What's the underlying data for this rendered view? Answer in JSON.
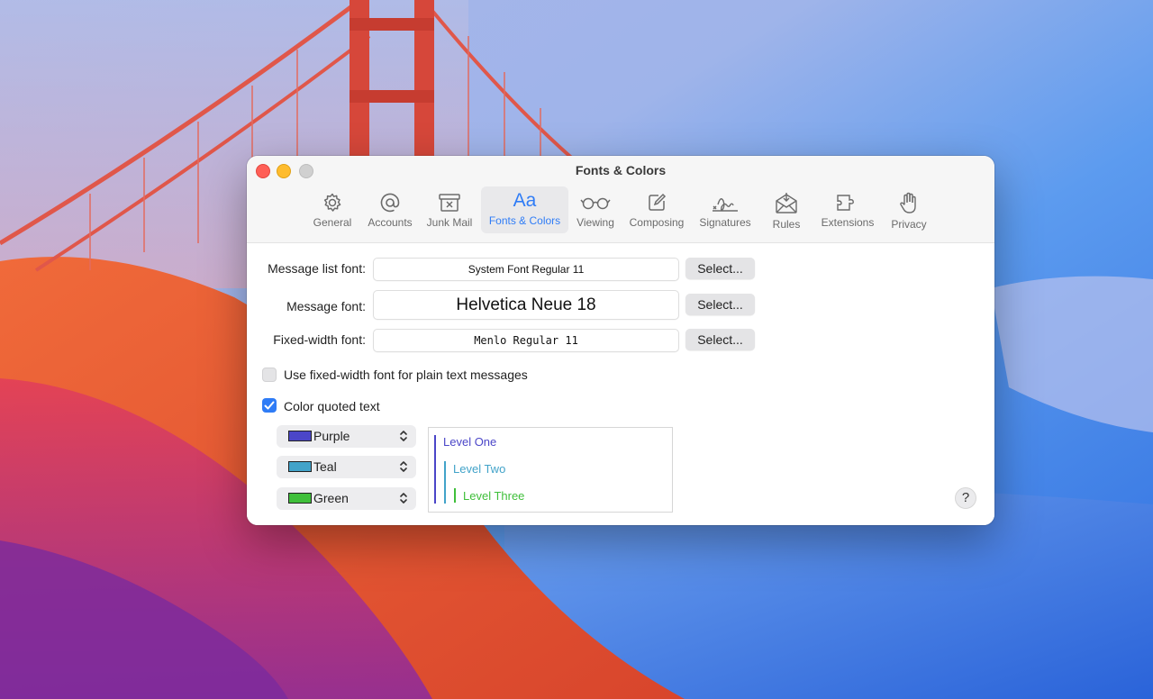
{
  "window": {
    "title": "Fonts & Colors"
  },
  "toolbar": {
    "items": [
      {
        "label": "General",
        "icon": "gear-icon"
      },
      {
        "label": "Accounts",
        "icon": "at-sign-icon"
      },
      {
        "label": "Junk Mail",
        "icon": "junk-mail-icon"
      },
      {
        "label": "Fonts & Colors",
        "icon": "fonts-icon",
        "glyph": "Aa",
        "selected": true
      },
      {
        "label": "Viewing",
        "icon": "glasses-icon"
      },
      {
        "label": "Composing",
        "icon": "compose-icon"
      },
      {
        "label": "Signatures",
        "icon": "signature-icon"
      },
      {
        "label": "Rules",
        "icon": "rules-envelope-icon"
      },
      {
        "label": "Extensions",
        "icon": "puzzle-icon"
      },
      {
        "label": "Privacy",
        "icon": "hand-icon"
      }
    ]
  },
  "fonts": {
    "message_list": {
      "label": "Message list font:",
      "value": "System Font Regular 11",
      "button": "Select..."
    },
    "message": {
      "label": "Message font:",
      "value": "Helvetica Neue 18",
      "button": "Select..."
    },
    "fixed_width": {
      "label": "Fixed-width font:",
      "value": "Menlo Regular 11",
      "button": "Select..."
    }
  },
  "options": {
    "use_fixed_width": {
      "label": "Use fixed-width font for plain text messages",
      "checked": false
    },
    "color_quoted": {
      "label": "Color quoted text",
      "checked": true
    }
  },
  "quote_colors": [
    {
      "name": "Purple",
      "color": "#4b46c8"
    },
    {
      "name": "Teal",
      "color": "#42a3c9"
    },
    {
      "name": "Green",
      "color": "#3fbf3a"
    }
  ],
  "preview": {
    "levels": [
      "Level One",
      "Level Two",
      "Level Three"
    ]
  },
  "help": {
    "label": "?"
  },
  "colors": {
    "accent": "#2f7cf6",
    "selected_tab_bg": "#e9e9eb"
  }
}
